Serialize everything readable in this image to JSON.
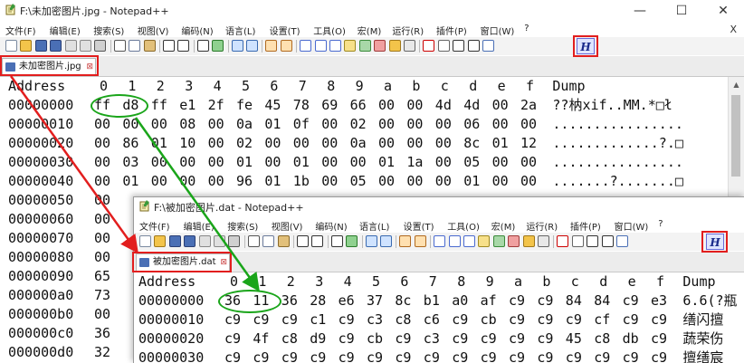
{
  "window1": {
    "title": "F:\\未加密图片.jpg - Notepad++",
    "controls": {
      "minimize": "—",
      "maximize": "☐",
      "close": "✕"
    },
    "menu_close": "X",
    "menu": [
      "文件(F)",
      "编辑(E)",
      "搜索(S)",
      "视图(V)",
      "编码(N)",
      "语言(L)",
      "设置(T)",
      "工具(O)",
      "宏(M)",
      "运行(R)",
      "插件(P)",
      "窗口(W)",
      "?"
    ],
    "tab_label": "未加密图片.jpg",
    "tab_close": "⊠",
    "hex_button": "H",
    "header": [
      "Address",
      "0",
      "1",
      "2",
      "3",
      "4",
      "5",
      "6",
      "7",
      "8",
      "9",
      "a",
      "b",
      "c",
      "d",
      "e",
      "f",
      "Dump"
    ],
    "rows": [
      {
        "addr": "00000000",
        "bytes": [
          "ff",
          "d8",
          "ff",
          "e1",
          "2f",
          "fe",
          "45",
          "78",
          "69",
          "66",
          "00",
          "00",
          "4d",
          "4d",
          "00",
          "2a"
        ],
        "dump": "??枘xif..MM.*□ł"
      },
      {
        "addr": "00000010",
        "bytes": [
          "00",
          "00",
          "00",
          "08",
          "00",
          "0a",
          "01",
          "0f",
          "00",
          "02",
          "00",
          "00",
          "00",
          "06",
          "00",
          "00"
        ],
        "dump": "................"
      },
      {
        "addr": "00000020",
        "bytes": [
          "00",
          "86",
          "01",
          "10",
          "00",
          "02",
          "00",
          "00",
          "00",
          "0a",
          "00",
          "00",
          "00",
          "8c",
          "01",
          "12"
        ],
        "dump": ".............?.□"
      },
      {
        "addr": "00000030",
        "bytes": [
          "00",
          "03",
          "00",
          "00",
          "00",
          "01",
          "00",
          "01",
          "00",
          "00",
          "01",
          "1a",
          "00",
          "05",
          "00",
          "00"
        ],
        "dump": "................"
      },
      {
        "addr": "00000040",
        "bytes": [
          "00",
          "01",
          "00",
          "00",
          "00",
          "96",
          "01",
          "1b",
          "00",
          "05",
          "00",
          "00",
          "00",
          "01",
          "00",
          "00"
        ],
        "dump": ".......?.......□"
      },
      {
        "addr": "00000050",
        "bytes": [
          "00"
        ],
        "dump": ""
      },
      {
        "addr": "00000060",
        "bytes": [
          "00"
        ],
        "dump": ""
      },
      {
        "addr": "00000070",
        "bytes": [
          "00"
        ],
        "dump": ""
      },
      {
        "addr": "00000080",
        "bytes": [
          "00"
        ],
        "dump": ""
      },
      {
        "addr": "00000090",
        "bytes": [
          "65"
        ],
        "dump": ""
      },
      {
        "addr": "000000a0",
        "bytes": [
          "73"
        ],
        "dump": ""
      },
      {
        "addr": "000000b0",
        "bytes": [
          "00"
        ],
        "dump": ""
      },
      {
        "addr": "000000c0",
        "bytes": [
          "36"
        ],
        "dump": ""
      },
      {
        "addr": "000000d0",
        "bytes": [
          "32"
        ],
        "dump": ""
      }
    ]
  },
  "window2": {
    "title": "F:\\被加密图片.dat - Notepad++",
    "menu": [
      "文件(F)",
      "编辑(E)",
      "搜索(S)",
      "视图(V)",
      "编码(N)",
      "语言(L)",
      "设置(T)",
      "工具(O)",
      "宏(M)",
      "运行(R)",
      "插件(P)",
      "窗口(W)",
      "?"
    ],
    "tab_label": "被加密图片.dat",
    "tab_close": "⊠",
    "hex_button": "H",
    "header": [
      "Address",
      "0",
      "1",
      "2",
      "3",
      "4",
      "5",
      "6",
      "7",
      "8",
      "9",
      "a",
      "b",
      "c",
      "d",
      "e",
      "f",
      "Dump"
    ],
    "rows": [
      {
        "addr": "00000000",
        "bytes": [
          "36",
          "11",
          "36",
          "28",
          "e6",
          "37",
          "8c",
          "b1",
          "a0",
          "af",
          "c9",
          "c9",
          "84",
          "84",
          "c9",
          "e3"
        ],
        "dump": "6.6(?瓶"
      },
      {
        "addr": "00000010",
        "bytes": [
          "c9",
          "c9",
          "c9",
          "c1",
          "c9",
          "c3",
          "c8",
          "c6",
          "c9",
          "cb",
          "c9",
          "c9",
          "c9",
          "cf",
          "c9",
          "c9"
        ],
        "dump": "缮闪擅"
      },
      {
        "addr": "00000020",
        "bytes": [
          "c9",
          "4f",
          "c8",
          "d9",
          "c9",
          "cb",
          "c9",
          "c3",
          "c9",
          "c9",
          "c9",
          "c9",
          "45",
          "c8",
          "db",
          "c9"
        ],
        "dump": "蔬荣伤"
      },
      {
        "addr": "00000030",
        "bytes": [
          "c9",
          "c9",
          "c9",
          "c9",
          "c9",
          "c9",
          "c9",
          "c9",
          "c9",
          "c9",
          "c9",
          "c9",
          "c9",
          "c9",
          "c9",
          "c9"
        ],
        "dump": "擅缮宸"
      }
    ]
  },
  "colors": {
    "annotation_red": "#e21e1e",
    "annotation_green": "#1aa51a",
    "hex_button_bg": "#dfe5ff"
  }
}
